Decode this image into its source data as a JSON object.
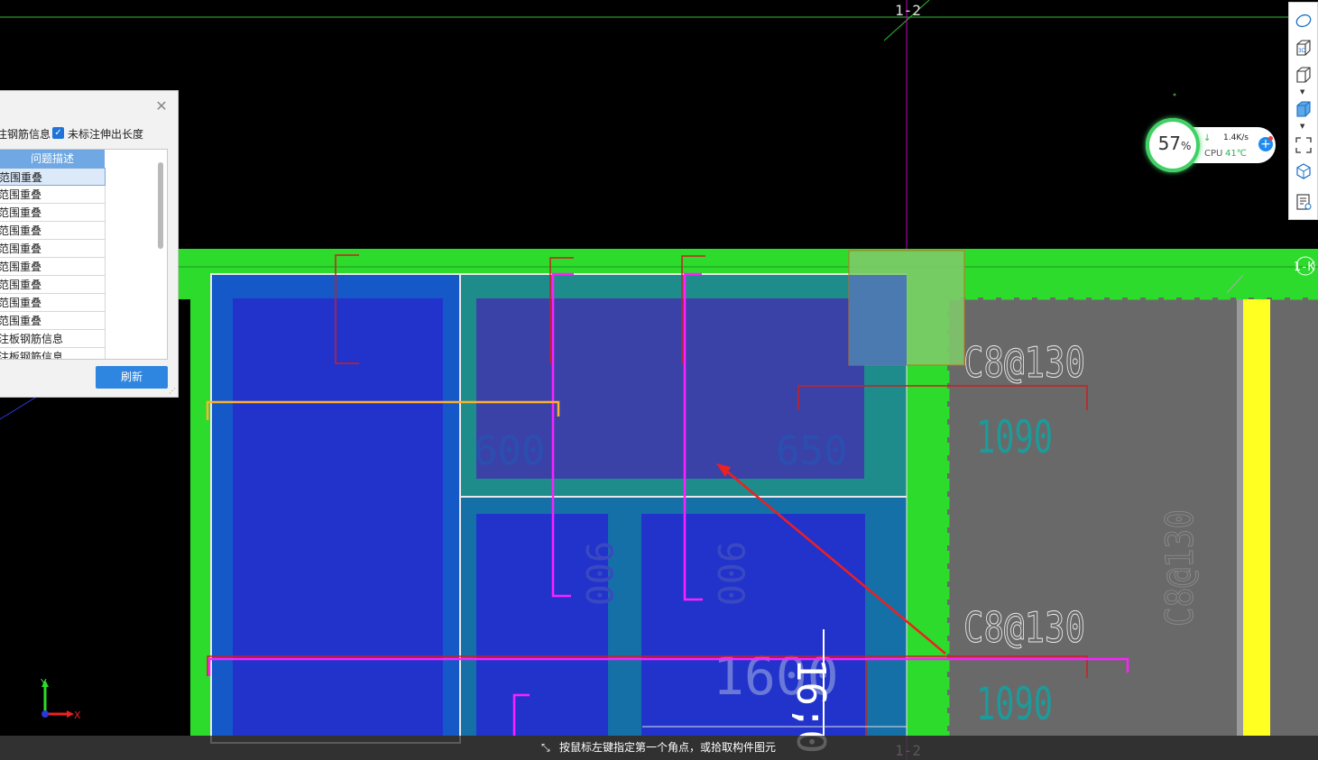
{
  "cad": {
    "axis_label_top": "1-2",
    "axis_label_bottom": "1-2",
    "axis_label_right": "1-K",
    "dim_labels": [
      "600",
      "650",
      "900",
      "900",
      "1600"
    ],
    "rebar_label_1": "C8@130",
    "rebar_label_2": "C8@130",
    "rebar_label_vertical": "C8@130",
    "length_label_1": "1090",
    "length_label_2": "1090",
    "big_vertical_label": "16;0",
    "axis_x": "X",
    "axis_y": "Y"
  },
  "check_panel": {
    "close_icon": "close-icon",
    "option1_label": "注钢筋信息",
    "option2_label": "未标注伸出长度",
    "option2_checked": true,
    "column_header": "问题描述",
    "rows": [
      "范围重叠",
      "范围重叠",
      "范围重叠",
      "范围重叠",
      "范围重叠",
      "范围重叠",
      "范围重叠",
      "范围重叠",
      "范围重叠",
      "注板钢筋信息",
      "注板钢筋信息"
    ],
    "selected_row": 0,
    "refresh_label": "刷新"
  },
  "toolbar": {
    "tools": [
      "orbit-icon",
      "3d-view-icon",
      "box-view-icon",
      "shaded-box-icon",
      "fullscreen-icon",
      "component-view-icon",
      "property-list-icon"
    ]
  },
  "perf": {
    "percent": "57",
    "percent_unit": "%",
    "net_speed": "1.4K/s",
    "cpu_label": "CPU",
    "cpu_temp": "41℃"
  },
  "status": {
    "message": "按鼠标左键指定第一个角点，或拾取构件图元"
  }
}
